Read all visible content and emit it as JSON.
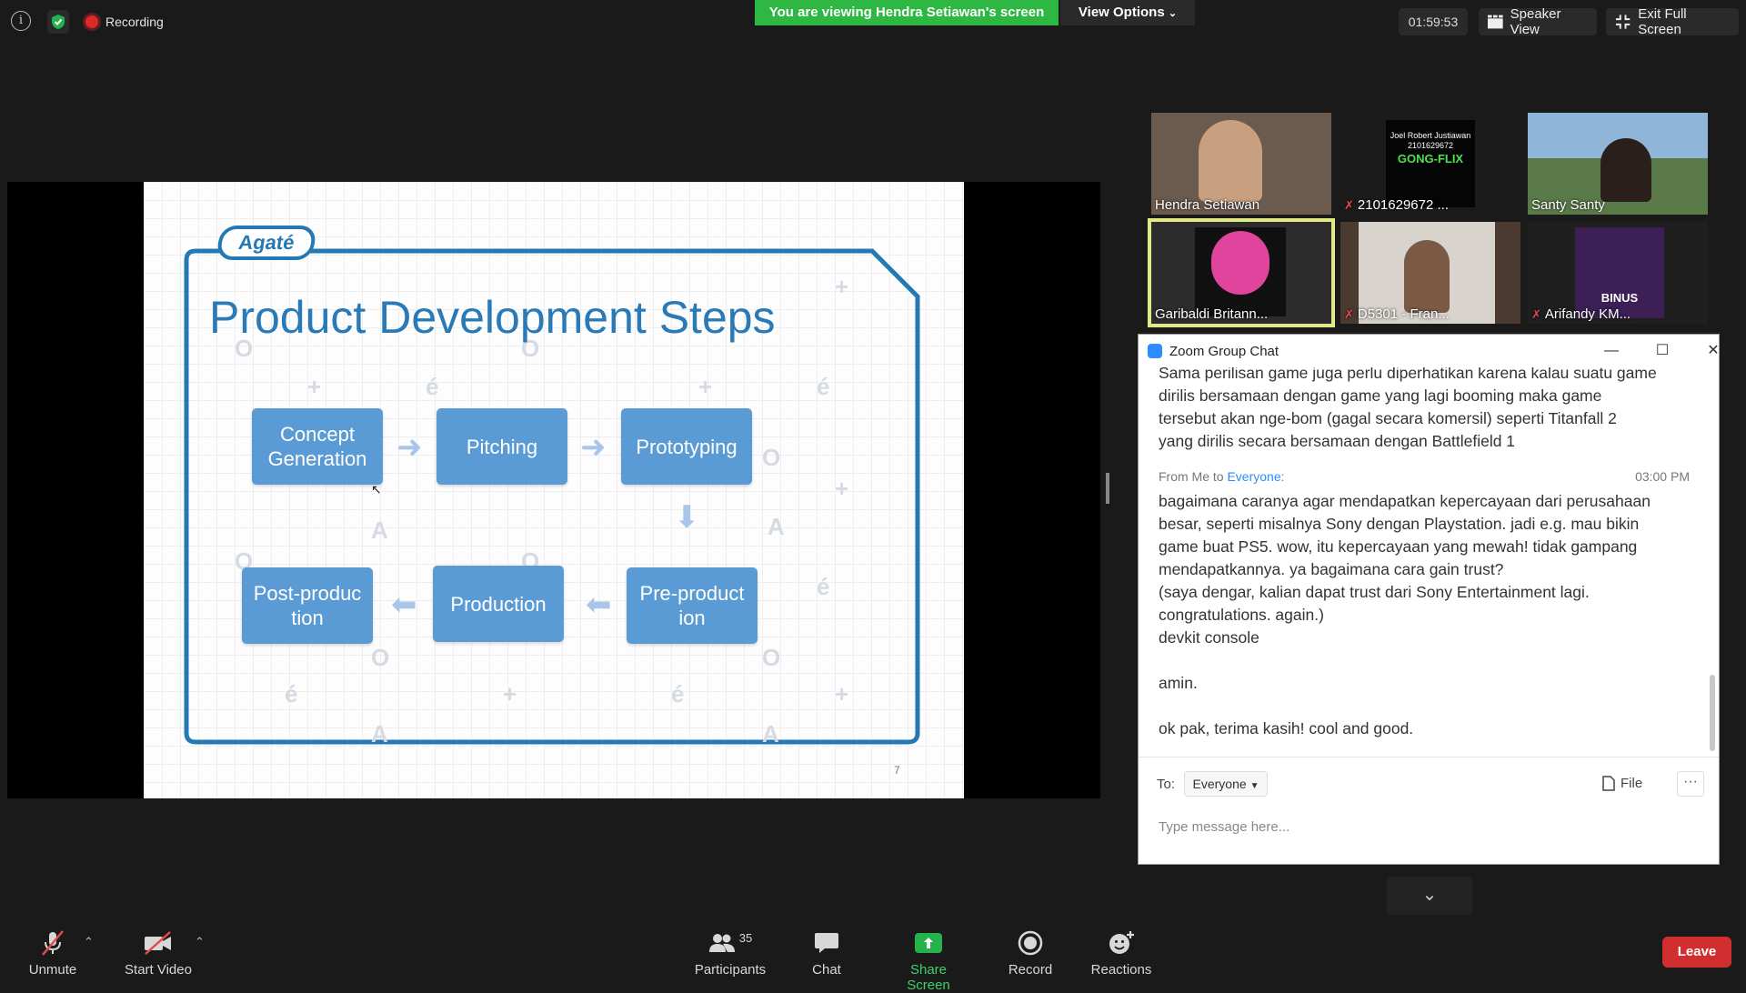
{
  "top_bar": {
    "recording_label": "Recording",
    "viewing_banner": "You are viewing Hendra Setiawan's screen",
    "view_options_label": "View Options",
    "timer": "01:59:53",
    "speaker_view_label": "Speaker View",
    "exit_fullscreen_label": "Exit Full Screen"
  },
  "slide": {
    "logo": "Agaté",
    "title": "Product Development Steps",
    "steps": [
      "Concept Generation",
      "Pitching",
      "Prototyping",
      "Pre-product ion",
      "Production",
      "Post-produc tion"
    ],
    "page_number": "7"
  },
  "participants_gallery": [
    {
      "name": "Hendra Setiawan",
      "muted": false,
      "active": false,
      "tile_color": "#6b5a4e"
    },
    {
      "name": "2101629672 ...",
      "muted": true,
      "active": false,
      "tile_color": "#0d0d0d",
      "card_text": [
        "Joel Robert Justiawan",
        "2101629672",
        "GONG-FLIX"
      ]
    },
    {
      "name": "Santy Santy",
      "muted": false,
      "active": false,
      "tile_color": "#8fb6d8"
    },
    {
      "name": "Garibaldi Britann...",
      "muted": false,
      "active": true,
      "tile_color": "#2c2c2c"
    },
    {
      "name": "D5301 - Fran...",
      "muted": true,
      "active": false,
      "tile_color": "#4a3a30"
    },
    {
      "name": "Arifandy KM...",
      "muted": true,
      "active": false,
      "tile_color": "#3b1f55",
      "card_text": [
        "BINUS"
      ]
    }
  ],
  "chat": {
    "window_title": "Zoom Group Chat",
    "earlier_message_lines": [
      "Sama perilisan game juga perlu diperhatikan karena kalau suatu game",
      "dirilis bersamaan dengan game yang lagi booming maka game",
      "tersebut akan nge-bom (gagal secara komersil) seperti Titanfall 2",
      "yang dirilis secara bersamaan dengan Battlefield 1"
    ],
    "my_message": {
      "from_label": "From Me to",
      "to_label": "Everyone:",
      "time": "03:00 PM",
      "lines": [
        "bagaimana caranya agar mendapatkan kepercayaan dari perusahaan",
        "besar, seperti misalnya Sony dengan Playstation. jadi e.g. mau bikin",
        "game buat PS5. wow, itu kepercayaan yang mewah! tidak gampang",
        "mendapatkannya. ya bagaimana cara gain trust?",
        "(saya dengar, kalian dapat trust dari Sony Entertainment lagi.",
        "congratulations. again.)",
        "devkit console",
        "",
        "amin.",
        "",
        "ok pak, terima kasih! cool and good."
      ]
    },
    "to_label": "To:",
    "recipient": "Everyone",
    "file_label": "File",
    "more_label": "···",
    "input_placeholder": "Type message here..."
  },
  "toolbar": {
    "unmute_label": "Unmute",
    "start_video_label": "Start Video",
    "participants_label": "Participants",
    "participants_count": "35",
    "chat_label": "Chat",
    "share_screen_label": "Share Screen",
    "record_label": "Record",
    "reactions_label": "Reactions",
    "leave_label": "Leave"
  },
  "colors": {
    "banner_green": "#2eb843",
    "leave_red": "#d12f2f",
    "slide_blue": "#2a7ab8",
    "step_box": "#5b9bd5",
    "chat_link_blue": "#2d8cff",
    "active_speaker_outline": "#e1e886"
  }
}
